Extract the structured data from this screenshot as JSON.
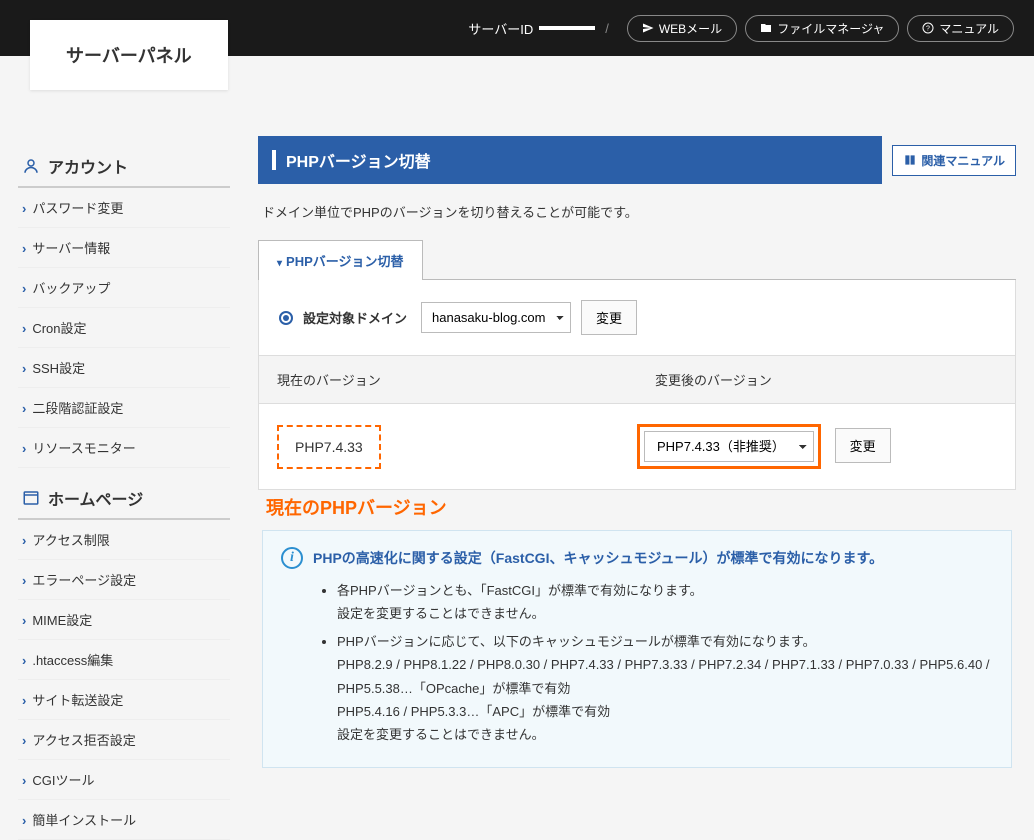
{
  "logo": "サーバーパネル",
  "topbar": {
    "server_id_label": "サーバーID",
    "server_id_value": " ",
    "webmail": "WEBメール",
    "file_manager": "ファイルマネージャ",
    "manual": "マニュアル"
  },
  "sidebar": {
    "cat_account": "アカウント",
    "account_items": [
      "パスワード変更",
      "サーバー情報",
      "バックアップ",
      "Cron設定",
      "SSH設定",
      "二段階認証設定",
      "リソースモニター"
    ],
    "cat_homepage": "ホームページ",
    "homepage_items": [
      "アクセス制限",
      "エラーページ設定",
      "MIME設定",
      ".htaccess編集",
      "サイト転送設定",
      "アクセス拒否設定",
      "CGIツール",
      "簡単インストール"
    ]
  },
  "main": {
    "page_title": "PHPバージョン切替",
    "related_manual": "関連マニュアル",
    "description": "ドメイン単位でPHPのバージョンを切り替えることが可能です。",
    "tab_label": "PHPバージョン切替",
    "domain_label": "設定対象ドメイン",
    "domain_value": "hanasaku-blog.com",
    "change_btn": "変更",
    "col_current": "現在のバージョン",
    "col_new": "変更後のバージョン",
    "current_version": "PHP7.4.33",
    "new_version": "PHP7.4.33（非推奨）",
    "annotation": "現在のPHPバージョン",
    "info_title": "PHPの高速化に関する設定（FastCGI、キャッシュモジュール）が標準で有効になります。",
    "info_bullet1": "各PHPバージョンとも、「FastCGI」が標準で有効になります。",
    "info_bullet1_sub": "設定を変更することはできません。",
    "info_bullet2": "PHPバージョンに応じて、以下のキャッシュモジュールが標準で有効になります。",
    "info_line_opcache": "PHP8.2.9 / PHP8.1.22 / PHP8.0.30 / PHP7.4.33 / PHP7.3.33 / PHP7.2.34 / PHP7.1.33 / PHP7.0.33 / PHP5.6.40 / PHP5.5.38…「OPcache」が標準で有効",
    "info_line_apc": "PHP5.4.16 / PHP5.3.3…「APC」が標準で有効",
    "info_line_noset": "設定を変更することはできません。"
  }
}
